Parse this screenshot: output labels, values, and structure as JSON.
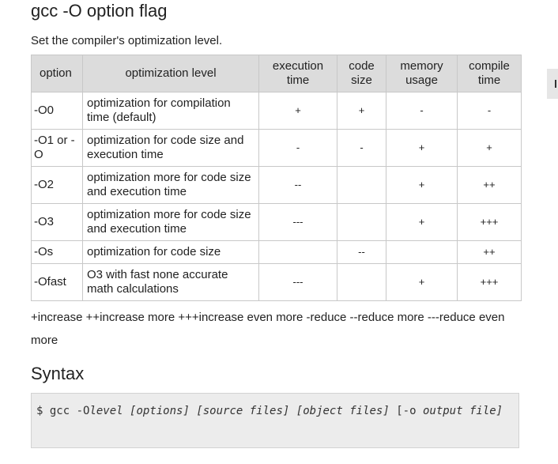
{
  "page": {
    "title": "gcc -O option flag",
    "intro": "Set the compiler's optimization level."
  },
  "table": {
    "headers": {
      "option": "option",
      "level": "optimization level",
      "exec_line1": "execution",
      "exec_line2": "time",
      "size_line1": "code",
      "size_line2": "size",
      "mem_line1": "memory",
      "mem_line2": "usage",
      "compile_line1": "compile",
      "compile_line2": "time"
    },
    "rows": [
      {
        "option": "-O0",
        "level": "optimization for compilation time (default)",
        "exec": "+",
        "size": "+",
        "mem": "-",
        "compile": "-"
      },
      {
        "option": "-O1 or -O",
        "level": "optimization for code size and execution time",
        "exec": "-",
        "size": "-",
        "mem": "+",
        "compile": "+"
      },
      {
        "option": "-O2",
        "level": "optimization more for code size and execution time",
        "exec": "--",
        "size": "",
        "mem": "+",
        "compile": "++"
      },
      {
        "option": "-O3",
        "level": "optimization more for code size and execution time",
        "exec": "---",
        "size": "",
        "mem": "+",
        "compile": "+++"
      },
      {
        "option": "-Os",
        "level": "optimization for code size",
        "exec": "",
        "size": "--",
        "mem": "",
        "compile": "++"
      },
      {
        "option": "-Ofast",
        "level": "O3 with fast none accurate math calculations",
        "exec": "---",
        "size": "",
        "mem": "+",
        "compile": "+++"
      }
    ]
  },
  "legend": "+increase ++increase more +++increase even more -reduce --reduce more ---reduce even more",
  "syntax": {
    "title": "Syntax",
    "prefix": "$ gcc -O",
    "level": "level",
    "options": "[options]",
    "source": "[source files]",
    "object": "[object files]",
    "output_flag": "[-o",
    "output_file": "output file]"
  }
}
